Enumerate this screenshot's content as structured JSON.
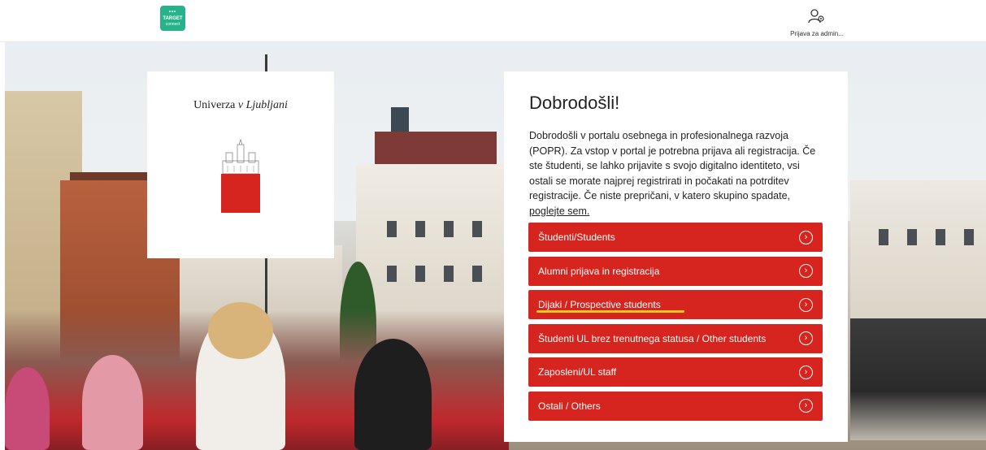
{
  "header": {
    "logo_line1": "TARGET",
    "logo_line2": "connect",
    "admin_label": "Prijava za admin..."
  },
  "university": {
    "name_plain": "Univerza ",
    "name_italic": "v Ljubljani"
  },
  "welcome": {
    "title": "Dobrodošli!",
    "intro": "Dobrodošli v portalu osebnega in profesionalnega razvoja (POPR). Za vstop v portal je potrebna prijava ali registracija. Če ste študenti, se lahko prijavite s svojo digitalno identiteto, vsi ostali se morate najprej registrirati in počakati na potrditev registracije. Če niste prepričani, v katero skupino spadate, ",
    "intro_link": "poglejte sem."
  },
  "buttons": [
    {
      "label": "Študenti/Students"
    },
    {
      "label": "Alumni prijava in registracija"
    },
    {
      "label": "Dijaki / Prospective students"
    },
    {
      "label": "Študenti UL brez trenutnega statusa / Other students"
    },
    {
      "label": "Zaposleni/UL staff"
    },
    {
      "label": "Ostali / Others"
    }
  ],
  "colors": {
    "brand_red": "#d6241e",
    "logo_green": "#27b38a",
    "highlight_yellow": "#f3c617"
  },
  "icons": {
    "button_chevron": "chevron-right-circle-icon",
    "admin": "user-gear-icon"
  }
}
